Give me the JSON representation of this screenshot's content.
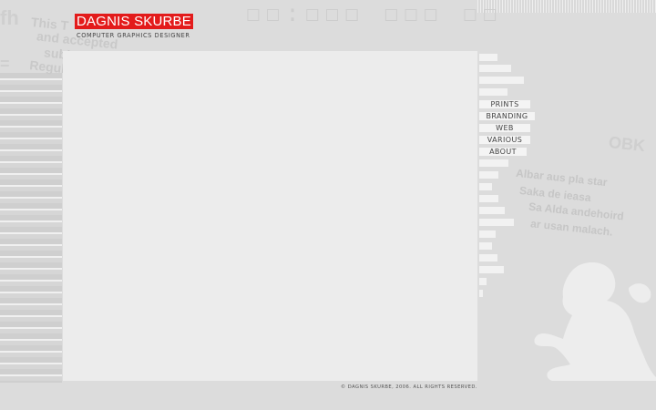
{
  "header": {
    "logo": "DAGNIS SKURBE",
    "subtitle": "COMPUTER GRAPHICS DESIGNER",
    "logo_color": "#e31b1b"
  },
  "background": {
    "left_text": [
      "This T",
      "and accepted",
      "subject to the",
      "Regulations of the Board."
    ],
    "right_text": [
      "Albar aus pla star",
      "Saka de ieasa",
      "Sa Alda andehoird",
      "ar usan malach."
    ],
    "right_big_text": "OBK"
  },
  "nav": {
    "items": [
      {
        "label": "PRINTS"
      },
      {
        "label": "BRANDING"
      },
      {
        "label": "WEB"
      },
      {
        "label": "VARIOUS"
      },
      {
        "label": "ABOUT"
      }
    ]
  },
  "footer": {
    "copyright": "© DAGNIS SKURBE, 2006. ALL RIGHTS RESERVED."
  },
  "icons": {
    "silhouette": "child-silhouette-icon"
  }
}
